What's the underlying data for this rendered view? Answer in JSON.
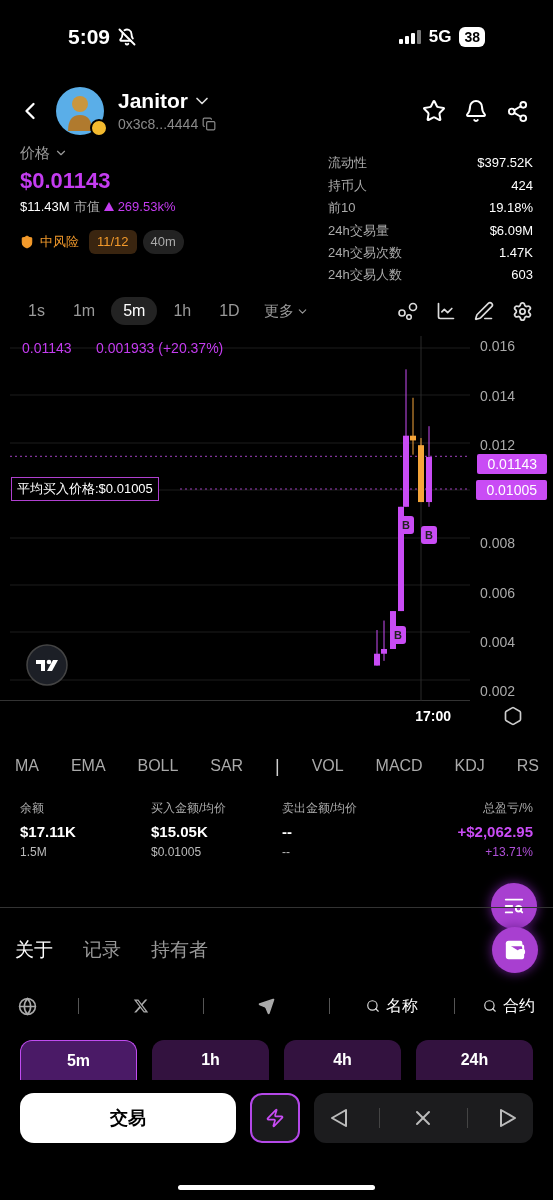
{
  "status_bar": {
    "time": "5:09",
    "network": "5G",
    "battery": "38"
  },
  "token": {
    "name": "Janitor",
    "address": "0x3c8...4444"
  },
  "price": {
    "label": "价格",
    "value": "$0.01143",
    "market_cap": "$11.43M",
    "market_cap_label": "市值",
    "change": "269.53k%"
  },
  "risk": {
    "label": "中风险",
    "score": "11/12",
    "age": "40m"
  },
  "stats": [
    {
      "label": "流动性",
      "value": "$397.52K"
    },
    {
      "label": "持币人",
      "value": "424"
    },
    {
      "label": "前10",
      "value": "19.18%"
    },
    {
      "label": "24h交易量",
      "value": "$6.09M"
    },
    {
      "label": "24h交易次数",
      "value": "1.47K"
    },
    {
      "label": "24h交易人数",
      "value": "603"
    }
  ],
  "timeframes": [
    {
      "label": "1s",
      "selected": false
    },
    {
      "label": "1m",
      "selected": false
    },
    {
      "label": "5m",
      "selected": true
    },
    {
      "label": "1h",
      "selected": false
    },
    {
      "label": "1D",
      "selected": false
    }
  ],
  "more": "更多",
  "chart": {
    "header_price": "0.01143",
    "header_change": "0.001933 (+20.37%)",
    "y_ticks": [
      "0.016",
      "0.014",
      "0.012",
      "0.008",
      "0.006",
      "0.004",
      "0.002"
    ],
    "avg_buy_label": "平均买入价格:$0.01005",
    "price_tags": [
      "0.01143",
      "0.01005"
    ],
    "buy_markers": [
      "B",
      "B",
      "B"
    ],
    "x_label": "17:00"
  },
  "indicators": [
    {
      "kind": "item",
      "label": "MA"
    },
    {
      "kind": "item",
      "label": "EMA"
    },
    {
      "kind": "item",
      "label": "BOLL"
    },
    {
      "kind": "item",
      "label": "SAR"
    },
    {
      "kind": "separator",
      "label": "|"
    },
    {
      "kind": "item",
      "label": "VOL"
    },
    {
      "kind": "item",
      "label": "MACD"
    },
    {
      "kind": "item",
      "label": "KDJ"
    },
    {
      "kind": "item",
      "label": "RS"
    }
  ],
  "holdings": [
    {
      "label": "余额",
      "primary": "$17.11K",
      "secondary": "1.5M",
      "positive": false
    },
    {
      "label": "买入金额/均价",
      "primary": "$15.05K",
      "secondary": "$0.01005",
      "positive": false
    },
    {
      "label": "卖出金额/均价",
      "primary": "--",
      "secondary": "--",
      "positive": false
    },
    {
      "label": "总盈亏/%",
      "primary": "+$2,062.95",
      "secondary": "+13.71%",
      "positive": true
    }
  ],
  "tabs": [
    {
      "label": "关于",
      "selected": true
    },
    {
      "label": "记录",
      "selected": false
    },
    {
      "label": "持有者",
      "selected": false
    }
  ],
  "links": [
    {
      "kind": "globe"
    },
    {
      "kind": "x"
    },
    {
      "kind": "telegram"
    },
    {
      "kind": "search",
      "label": "名称"
    },
    {
      "kind": "search",
      "label": "合约"
    }
  ],
  "periods": [
    {
      "label": "5m",
      "selected": true
    },
    {
      "label": "1h",
      "selected": false
    },
    {
      "label": "4h",
      "selected": false
    },
    {
      "label": "24h",
      "selected": false
    }
  ],
  "trade_button": "交易"
}
